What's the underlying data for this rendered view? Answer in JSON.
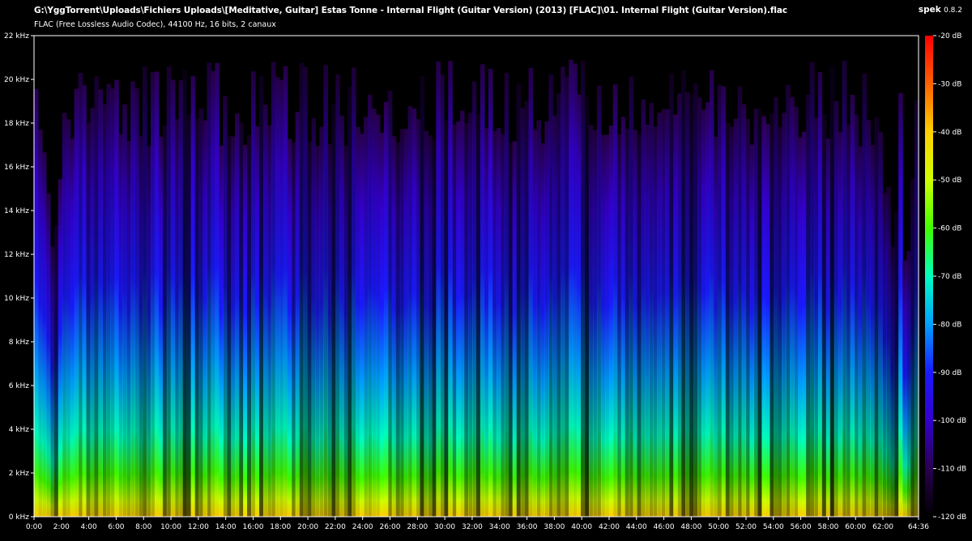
{
  "header": {
    "file_path": "G:\\YggTorrent\\Uploads\\Fichiers Uploads\\[Meditative, Guitar] Estas Tonne - Internal Flight (Guitar Version) (2013) [FLAC]\\01. Internal Flight (Guitar Version).flac",
    "file_info": "FLAC (Free Lossless Audio Codec), 44100 Hz, 16 bits, 2 canaux",
    "app_name": "spek",
    "app_version": "0.8.2"
  },
  "chart_data": {
    "type": "heatmap",
    "title": "",
    "x_axis": {
      "unit": "minutes:seconds",
      "range": [
        "0:00",
        "64:36"
      ],
      "tick_labels": [
        "0:00",
        "2:00",
        "4:00",
        "6:00",
        "8:00",
        "10:00",
        "12:00",
        "14:00",
        "16:00",
        "18:00",
        "20:00",
        "22:00",
        "24:00",
        "26:00",
        "28:00",
        "30:00",
        "32:00",
        "34:00",
        "36:00",
        "38:00",
        "40:00",
        "42:00",
        "44:00",
        "46:00",
        "48:00",
        "50:00",
        "52:00",
        "54:00",
        "56:00",
        "58:00",
        "60:00",
        "62:00",
        "64:36"
      ]
    },
    "y_axis": {
      "unit": "kHz",
      "range": [
        0,
        22
      ],
      "tick_labels": [
        "0 kHz",
        "2 kHz",
        "4 kHz",
        "6 kHz",
        "8 kHz",
        "10 kHz",
        "12 kHz",
        "14 kHz",
        "16 kHz",
        "18 kHz",
        "20 kHz",
        "22 kHz"
      ]
    },
    "color_scale": {
      "unit": "dB",
      "range": [
        -120,
        -20
      ],
      "tick_labels": [
        "-20 dB",
        "-30 dB",
        "-40 dB",
        "-50 dB",
        "-60 dB",
        "-70 dB",
        "-80 dB",
        "-90 dB",
        "-100 dB",
        "-110 dB",
        "-120 dB"
      ],
      "colors": [
        "#000000",
        "#2a0050",
        "#3300cc",
        "#1a1aff",
        "#00a0ff",
        "#00ffc0",
        "#40ff00",
        "#d0ff00",
        "#ffd000",
        "#ff6000",
        "#ff0000"
      ]
    },
    "grid": false
  }
}
